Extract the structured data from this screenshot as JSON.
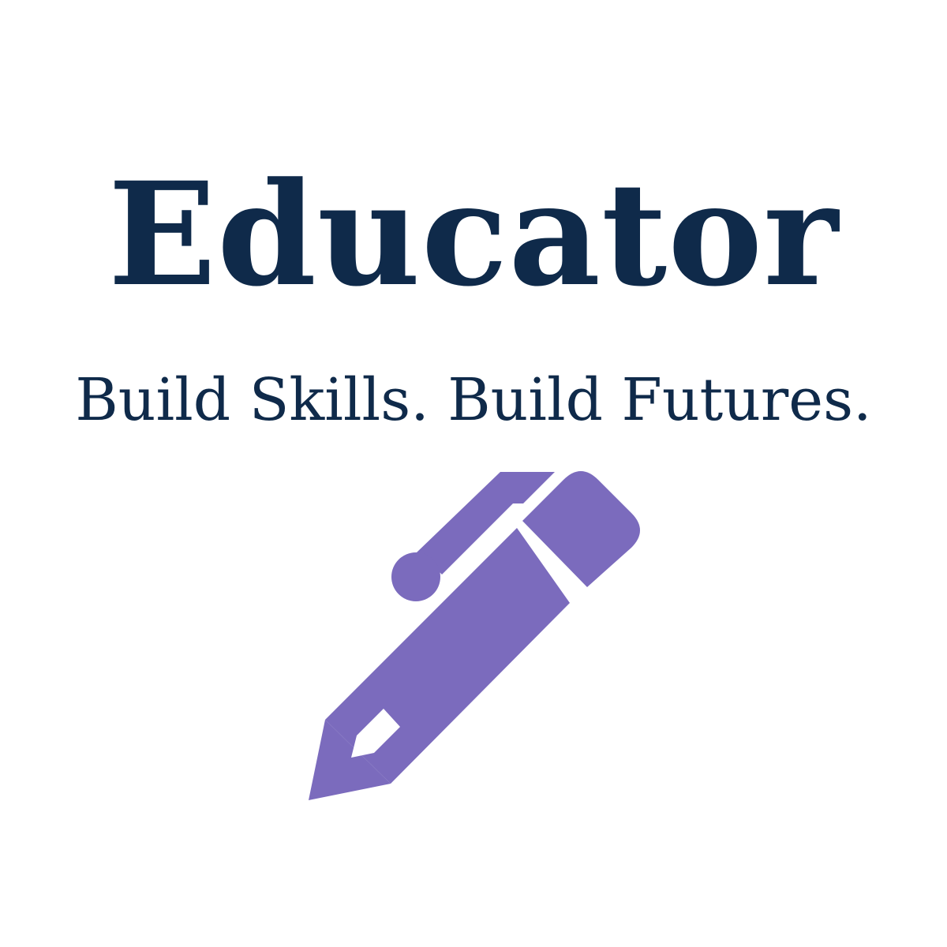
{
  "logo": {
    "title": "Educator",
    "tagline": "Build Skills. Build Futures.",
    "icon": "pen-icon"
  },
  "colors": {
    "text": "#0f2a4a",
    "icon": "#7b6bbd",
    "background": "#ffffff"
  }
}
